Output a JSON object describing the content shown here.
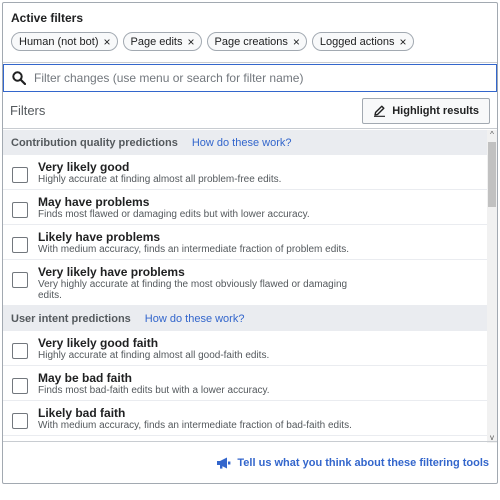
{
  "active_filters": {
    "title": "Active filters",
    "chips": [
      {
        "label": "Human (not bot)",
        "remove": "×"
      },
      {
        "label": "Page edits",
        "remove": "×"
      },
      {
        "label": "Page creations",
        "remove": "×"
      },
      {
        "label": "Logged actions",
        "remove": "×"
      }
    ]
  },
  "search": {
    "placeholder": "Filter changes (use menu or search for filter name)",
    "icon": "search-icon"
  },
  "filters_bar": {
    "label": "Filters",
    "highlight_button": "Highlight results",
    "highlight_icon": "pencil-icon"
  },
  "groups": [
    {
      "title": "Contribution quality predictions",
      "link": "How do these work?",
      "items": [
        {
          "label": "Very likely good",
          "desc": "Highly accurate at finding almost all problem-free edits."
        },
        {
          "label": "May have problems",
          "desc": "Finds most flawed or damaging edits but with lower accuracy."
        },
        {
          "label": "Likely have problems",
          "desc": "With medium accuracy, finds an intermediate fraction of problem edits."
        },
        {
          "label": "Very likely have problems",
          "desc": "Very highly accurate at finding the most obviously flawed or damaging edits."
        }
      ]
    },
    {
      "title": "User intent predictions",
      "link": "How do these work?",
      "items": [
        {
          "label": "Very likely good faith",
          "desc": "Highly accurate at finding almost all good-faith edits."
        },
        {
          "label": "May be bad faith",
          "desc": "Finds most bad-faith edits but with a lower accuracy."
        },
        {
          "label": "Likely bad faith",
          "desc": "With medium accuracy, finds an intermediate fraction of bad-faith edits."
        }
      ]
    }
  ],
  "scrollbar": {
    "up": "^",
    "down": "v"
  },
  "footer": {
    "feedback_link": "Tell us what you think about these filtering tools",
    "feedback_icon": "megaphone-icon"
  },
  "colors": {
    "accent": "#3366cc",
    "border": "#a2a9b1",
    "group_bg": "#eaecf0"
  }
}
